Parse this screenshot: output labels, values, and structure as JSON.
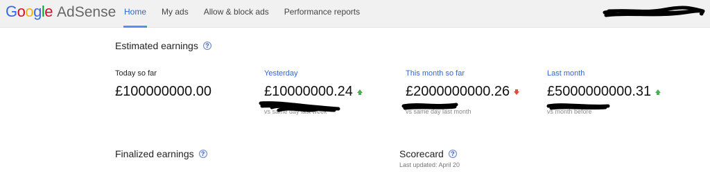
{
  "header": {
    "logo_google": "Google",
    "logo_product": "AdSense",
    "nav": [
      {
        "label": "Home",
        "active": true
      },
      {
        "label": "My ads",
        "active": false
      },
      {
        "label": "Allow & block ads",
        "active": false
      },
      {
        "label": "Performance reports",
        "active": false
      }
    ]
  },
  "estimated": {
    "title": "Estimated earnings",
    "metrics": [
      {
        "label": "Today so far",
        "value": "£100000000.00",
        "trend": "none",
        "comparison": ""
      },
      {
        "label": "Yesterday",
        "value": "£10000000.24",
        "trend": "up",
        "comparison": "vs same day last week"
      },
      {
        "label": "This month so far",
        "value": "£2000000000.26",
        "trend": "down",
        "comparison": "vs same day last month"
      },
      {
        "label": "Last month",
        "value": "£5000000000.31",
        "trend": "up",
        "comparison": "vs month before"
      }
    ]
  },
  "finalized": {
    "title": "Finalized earnings"
  },
  "scorecard": {
    "title": "Scorecard",
    "updated": "Last updated: April 20"
  },
  "colors": {
    "accent": "#3366cc",
    "tab_underline": "#4d90fe",
    "up": "#4caf50",
    "down": "#dd4b39"
  }
}
